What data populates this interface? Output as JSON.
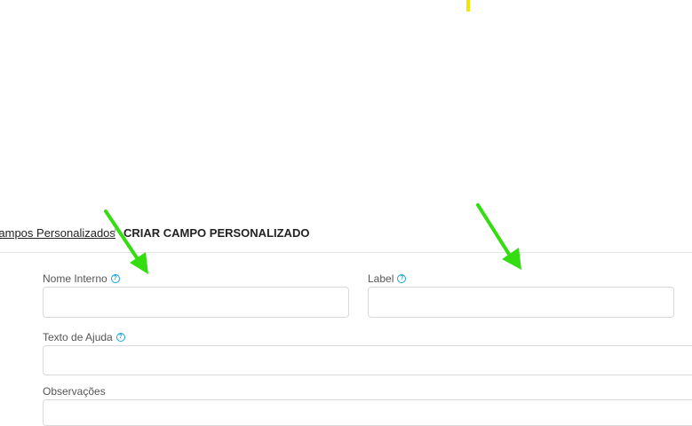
{
  "breadcrumb": {
    "parent": "Campos Personalizados",
    "separator": "/",
    "current": "CRIAR CAMPO PERSONALIZADO"
  },
  "form": {
    "nome_interno": {
      "label": "Nome Interno",
      "value": "",
      "help_icon": "question-circle-icon"
    },
    "label": {
      "label": "Label",
      "value": "",
      "help_icon": "question-circle-icon"
    },
    "texto_ajuda": {
      "label": "Texto de Ajuda",
      "value": "",
      "help_icon": "question-circle-icon"
    },
    "observacoes": {
      "label": "Observações",
      "value": ""
    }
  },
  "colors": {
    "arrow": "#33dd11",
    "accent": "#1aa3d9",
    "marker": "#f2e600"
  },
  "annotations": {
    "arrows": [
      "arrow-to-nome-interno",
      "arrow-to-label"
    ]
  }
}
